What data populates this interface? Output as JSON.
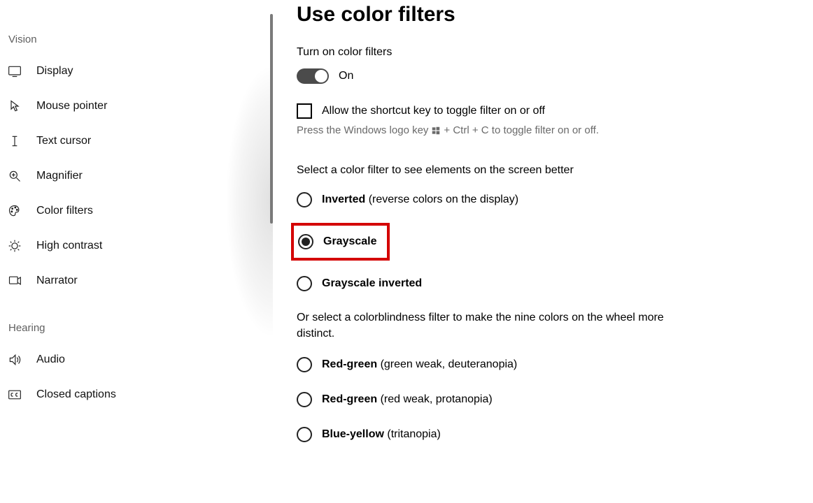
{
  "sidebar": {
    "groups": [
      {
        "label": "Vision",
        "items": [
          {
            "label": "Display"
          },
          {
            "label": "Mouse pointer"
          },
          {
            "label": "Text cursor"
          },
          {
            "label": "Magnifier"
          },
          {
            "label": "Color filters"
          },
          {
            "label": "High contrast"
          },
          {
            "label": "Narrator"
          }
        ]
      },
      {
        "label": "Hearing",
        "items": [
          {
            "label": "Audio"
          },
          {
            "label": "Closed captions"
          }
        ]
      }
    ]
  },
  "page": {
    "title": "Use color filters",
    "toggle_section_label": "Turn on color filters",
    "toggle_state": "On",
    "shortcut_checkbox_label": "Allow the shortcut key to toggle filter on or off",
    "shortcut_hint_pre": "Press the Windows logo key",
    "shortcut_hint_post": "+ Ctrl + C to toggle filter on or off.",
    "select_label": "Select a color filter to see elements on the screen better",
    "filters": [
      {
        "name": "Inverted",
        "desc": "(reverse colors on the display)",
        "checked": false
      },
      {
        "name": "Grayscale",
        "desc": "",
        "checked": true,
        "highlighted": true
      },
      {
        "name": "Grayscale inverted",
        "desc": "",
        "checked": false
      }
    ],
    "cb_intro": "Or select a colorblindness filter to make the nine colors on the wheel more distinct.",
    "cb_filters": [
      {
        "name": "Red-green",
        "desc": "(green weak, deuteranopia)"
      },
      {
        "name": "Red-green",
        "desc": "(red weak, protanopia)"
      },
      {
        "name": "Blue-yellow",
        "desc": "(tritanopia)"
      }
    ]
  }
}
